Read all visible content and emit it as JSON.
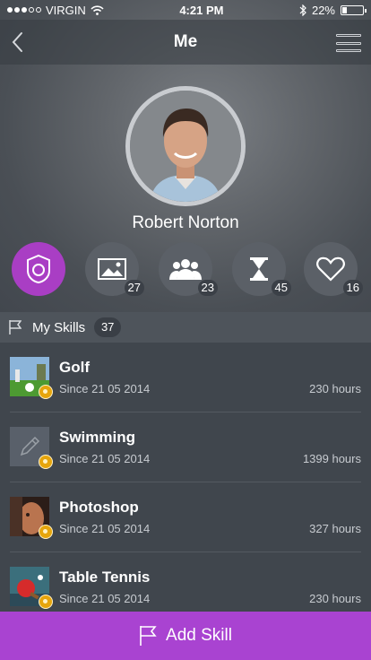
{
  "status_bar": {
    "carrier": "VIRGIN",
    "time": "4:21 PM",
    "battery": "22%",
    "battery_level": 0.22
  },
  "nav": {
    "title": "Me"
  },
  "profile": {
    "name": "Robert Norton"
  },
  "stats": [
    {
      "icon": "badge-icon",
      "count": ""
    },
    {
      "icon": "image-icon",
      "count": "27"
    },
    {
      "icon": "people-icon",
      "count": "23"
    },
    {
      "icon": "hourglass-icon",
      "count": "45"
    },
    {
      "icon": "heart-icon",
      "count": "16"
    }
  ],
  "section": {
    "title": "My Skills",
    "count": "37"
  },
  "skills": [
    {
      "name": "Golf",
      "since": "Since 21 05 2014",
      "hours": "230 hours"
    },
    {
      "name": "Swimming",
      "since": "Since 21 05 2014",
      "hours": "1399 hours"
    },
    {
      "name": "Photoshop",
      "since": "Since 21 05 2014",
      "hours": "327 hours"
    },
    {
      "name": "Table Tennis",
      "since": "Since 21 05 2014",
      "hours": "230 hours"
    }
  ],
  "add_button": {
    "label": "Add Skill"
  },
  "colors": {
    "accent": "#a943d1",
    "badge": "#e6a50d",
    "background": "#3e444c"
  }
}
